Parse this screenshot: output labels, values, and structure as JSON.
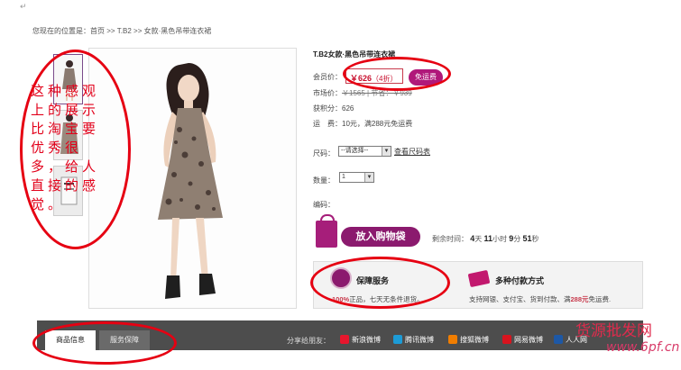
{
  "page": {
    "return_mark": "↵",
    "breadcrumb": "您现在的位置是：首页 >> T.B2 >> 女款·黑色吊带连衣裙"
  },
  "product": {
    "title": "T.B2女款·黑色吊带连衣裙",
    "member_price_label": "会员价：",
    "member_price": "￥626",
    "discount": "（4折）",
    "free_shipping": "免运费",
    "market_price_label": "市场价：",
    "market_price": "￥1565 | 节省：￥939",
    "points_label": "获积分：",
    "points": "626",
    "shipping_label": "运　费：",
    "shipping": "10元，满288元免运费",
    "size_label": "尺码：",
    "size_select": "--请选择--",
    "size_chart_link": "查看尺码表",
    "quantity_label": "数量：",
    "quantity_value": "1",
    "sku_label": "编码：",
    "add_to_cart": "放入购物袋",
    "countdown_label": "剩余时间：",
    "countdown": {
      "days": "4",
      "days_unit": "天",
      "hours": "11",
      "hours_unit": "小时",
      "minutes": "9",
      "minutes_unit": "分",
      "seconds": "51",
      "seconds_unit": "秒"
    }
  },
  "services": {
    "guarantee_title": "保障服务",
    "guarantee_desc_highlight": "100%",
    "guarantee_desc": "正品，七天无条件退货。",
    "payment_title": "多种付款方式",
    "payment_desc": "支持网银、支付宝、货到付款、满",
    "payment_desc_highlight": "288元",
    "payment_desc_tail": "免运费."
  },
  "tabs": [
    "商品信息",
    "服务保障"
  ],
  "share": {
    "label": "分享给朋友：",
    "items": [
      {
        "label": "新浪微博",
        "color": "#e6162d"
      },
      {
        "label": "腾讯微博",
        "color": "#1c9bd6"
      },
      {
        "label": "搜狐微博",
        "color": "#f07d00"
      },
      {
        "label": "网易微博",
        "color": "#d8141e"
      },
      {
        "label": "人人网",
        "color": "#1d58a6"
      }
    ]
  },
  "annotation": {
    "text": "这种感观上的展示比淘宝要优秀很多，给人直接的感觉。",
    "color": "#e60012"
  },
  "watermark": {
    "text": "货源批发网",
    "url": "www.6pf.cn"
  },
  "colors": {
    "accent": "#8b1a6e",
    "price": "#c8102e",
    "annotation": "#e60012",
    "tab_bar": "#4d4d4d"
  }
}
